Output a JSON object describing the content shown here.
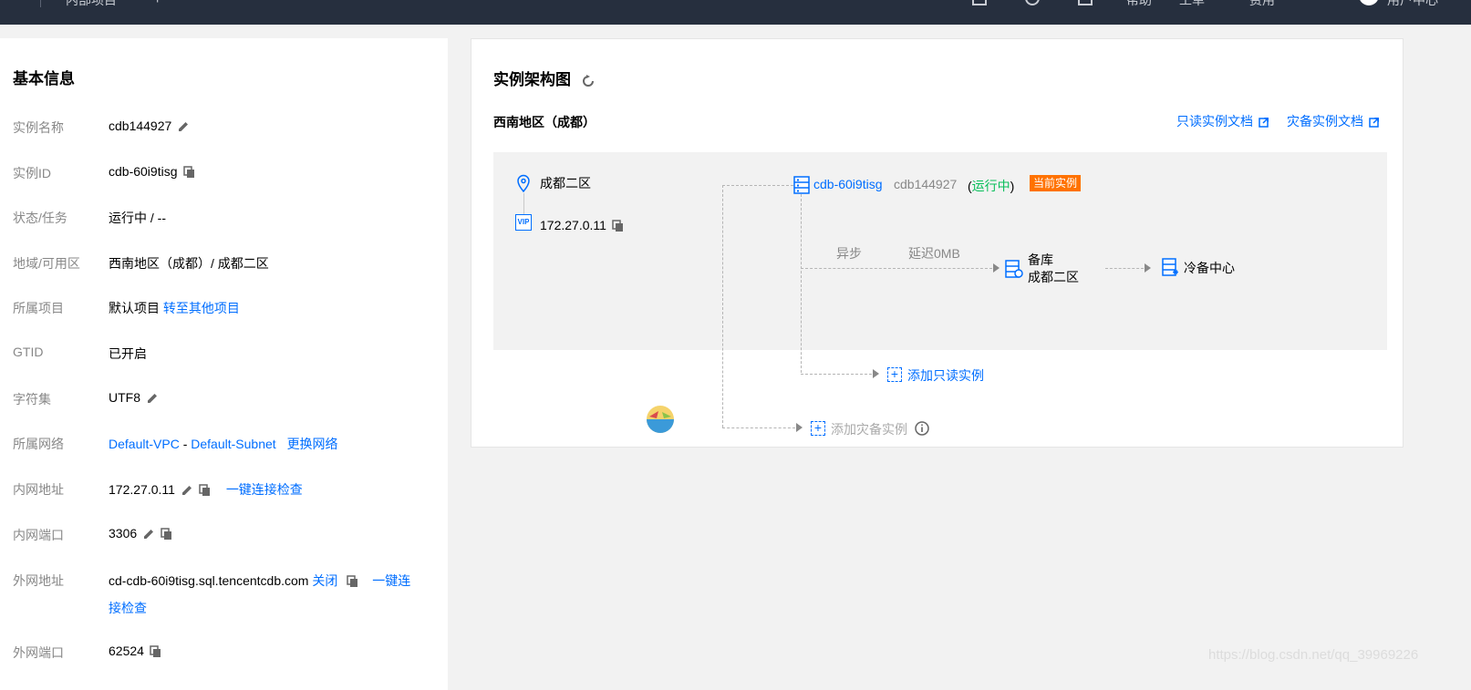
{
  "topbar": {
    "breadcrumb": "内部项目",
    "links": [
      "帮助",
      "工单",
      "费用",
      "用户中心"
    ]
  },
  "basic_info": {
    "title": "基本信息",
    "rows": [
      {
        "label": "实例名称",
        "value": "cdb144927"
      },
      {
        "label": "实例ID",
        "value": "cdb-60i9tisg"
      },
      {
        "label": "状态/任务",
        "value": "运行中 / --"
      },
      {
        "label": "地域/可用区",
        "value": "西南地区（成都）/ 成都二区"
      },
      {
        "label": "所属项目",
        "value": "默认项目",
        "link": "转至其他项目"
      },
      {
        "label": "GTID",
        "value": "已开启"
      },
      {
        "label": "字符集",
        "value": "UTF8"
      },
      {
        "label": "所属网络",
        "vpc": "Default-VPC",
        "dash": "-",
        "subnet": "Default-Subnet",
        "link": "更换网络"
      },
      {
        "label": "内网地址",
        "value": "172.27.0.11",
        "link": "一键连接检查"
      },
      {
        "label": "内网端口",
        "value": "3306"
      },
      {
        "label": "外网地址",
        "value": "cd-cdb-60i9tisg.sql.tencentcdb.com",
        "close": "关闭",
        "link_a": "一键连",
        "link_b": "接检查"
      },
      {
        "label": "外网端口",
        "value": "62524"
      }
    ]
  },
  "architecture": {
    "title": "实例架构图",
    "region": "西南地区（成都）",
    "doc_links": [
      "只读实例文档",
      "灾备实例文档"
    ],
    "zone": "成都二区",
    "vip_label": "VIP",
    "vip": "172.27.0.11",
    "instance_id": "cdb-60i9tisg",
    "instance_name": "cdb144927",
    "status_open": "(",
    "status": "运行中",
    "status_close": ")",
    "current_badge": "当前实例",
    "sync_mode": "异步",
    "delay": "延迟0MB",
    "standby_title": "备库",
    "standby_zone": "成都二区",
    "cold_backup": "冷备中心",
    "add_readonly": "添加只读实例",
    "add_disaster": "添加灾备实例"
  },
  "watermark": "https://blog.csdn.net/qq_39969226",
  "colors": {
    "link": "#006eff",
    "running": "#0abf5b",
    "badge": "#ff7200",
    "topbar": "#262f3e"
  }
}
